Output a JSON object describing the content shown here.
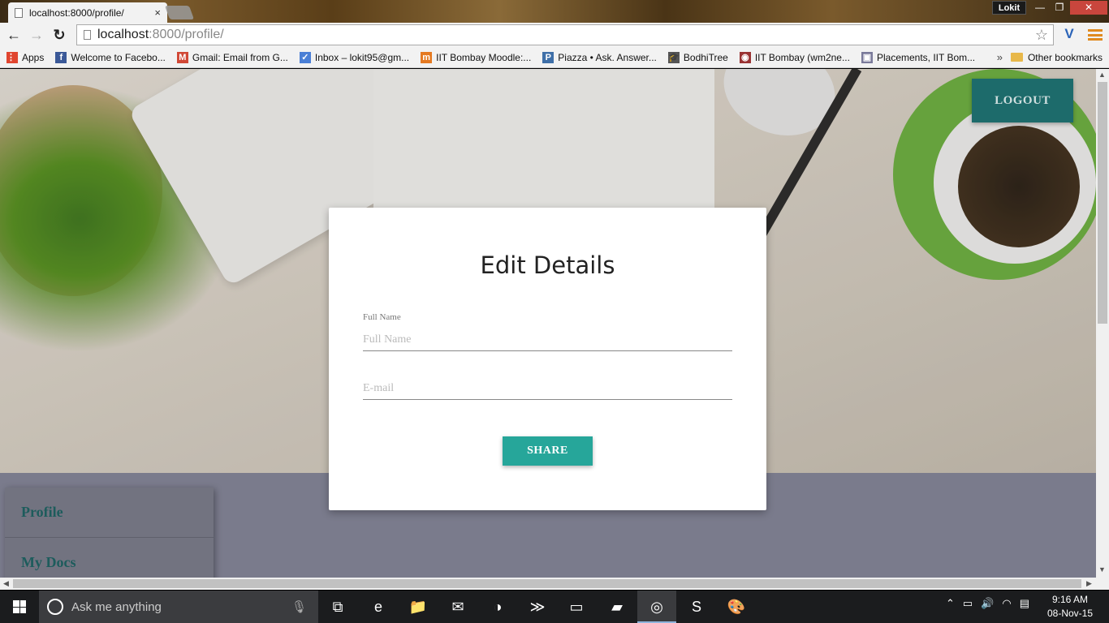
{
  "browser": {
    "tab_title": "localhost:8000/profile/",
    "tab_close": "×",
    "profile_name": "Lokit",
    "window_controls": {
      "minimize": "—",
      "maximize": "❐",
      "close": "✕"
    },
    "back": "←",
    "forward": "→",
    "reload": "↻",
    "address_host": "localhost",
    "address_path": ":8000/profile/",
    "star": "☆",
    "extension_icon": "V",
    "bookmarks": [
      {
        "label": "Apps",
        "icon": "apps-grid-icon",
        "color": "#e0452f",
        "glyph": "⋮⋮"
      },
      {
        "label": "Welcome to Facebo...",
        "icon": "facebook-icon",
        "color": "#3b5998",
        "glyph": "f"
      },
      {
        "label": "Gmail: Email from G...",
        "icon": "gmail-icon",
        "color": "#d14836",
        "glyph": "M"
      },
      {
        "label": "Inbox – lokit95@gm...",
        "icon": "inbox-icon",
        "color": "#4a7fd6",
        "glyph": "✓"
      },
      {
        "label": "IIT Bombay Moodle:...",
        "icon": "moodle-icon",
        "color": "#e57a22",
        "glyph": "m"
      },
      {
        "label": "Piazza • Ask. Answer...",
        "icon": "piazza-icon",
        "color": "#3f6fa8",
        "glyph": "P"
      },
      {
        "label": "BodhiTree",
        "icon": "bodhitree-icon",
        "color": "#555555",
        "glyph": "🎓"
      },
      {
        "label": "IIT Bombay (wm2ne...",
        "icon": "iitb-icon",
        "color": "#9a3333",
        "glyph": "◉"
      },
      {
        "label": "Placements, IIT Bom...",
        "icon": "placements-icon",
        "color": "#7a7a9a",
        "glyph": "▣"
      }
    ],
    "bookmarks_overflow": "»",
    "other_bookmarks": "Other bookmarks"
  },
  "page": {
    "logout_label": "LOGOUT",
    "form": {
      "title": "Edit Details",
      "full_name_label": "Full Name",
      "full_name_placeholder": "Full Name",
      "full_name_value": "",
      "email_placeholder": "E-mail",
      "email_value": "",
      "submit_label": "SHARE"
    },
    "sidebar": {
      "items": [
        {
          "label": "Profile"
        },
        {
          "label": "My Docs"
        }
      ]
    },
    "accent_color": "#26a69a",
    "dark_teal": "#1d6b6b"
  },
  "taskbar": {
    "search_placeholder": "Ask me anything",
    "apps": [
      {
        "name": "task-view-icon",
        "glyph": "⧉"
      },
      {
        "name": "edge-icon",
        "glyph": "e"
      },
      {
        "name": "file-explorer-icon",
        "glyph": "📁"
      },
      {
        "name": "mail-icon",
        "glyph": "✉"
      },
      {
        "name": "photos-icon",
        "glyph": "◑"
      },
      {
        "name": "powershell-icon",
        "glyph": "≫"
      },
      {
        "name": "cmd-icon",
        "glyph": "▭"
      },
      {
        "name": "folder-icon",
        "glyph": "▰"
      },
      {
        "name": "chrome-icon",
        "glyph": "◎"
      },
      {
        "name": "sublime-icon",
        "glyph": "S"
      },
      {
        "name": "paint-icon",
        "glyph": "🎨"
      }
    ],
    "time": "9:16 AM",
    "date": "08-Nov-15"
  }
}
